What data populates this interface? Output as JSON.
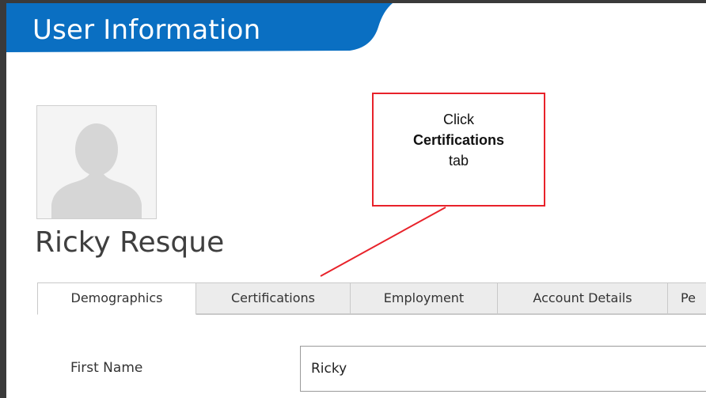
{
  "header": {
    "title": "User Information"
  },
  "profile": {
    "name": "Ricky Resque",
    "avatar_icon": "person-silhouette-icon"
  },
  "tabs": [
    {
      "label": "Demographics",
      "active": true
    },
    {
      "label": "Certifications",
      "active": false
    },
    {
      "label": "Employment",
      "active": false
    },
    {
      "label": "Account Details",
      "active": false
    },
    {
      "label": "Pe",
      "active": false
    }
  ],
  "form": {
    "first_name_label": "First Name",
    "first_name_value": "Ricky"
  },
  "callout": {
    "line1": "Click",
    "line2": "Certifications",
    "line3": "tab"
  },
  "colors": {
    "header_blue": "#0a6fc2",
    "callout_red": "#e8222a",
    "frame_dark": "#3a3a3a"
  }
}
